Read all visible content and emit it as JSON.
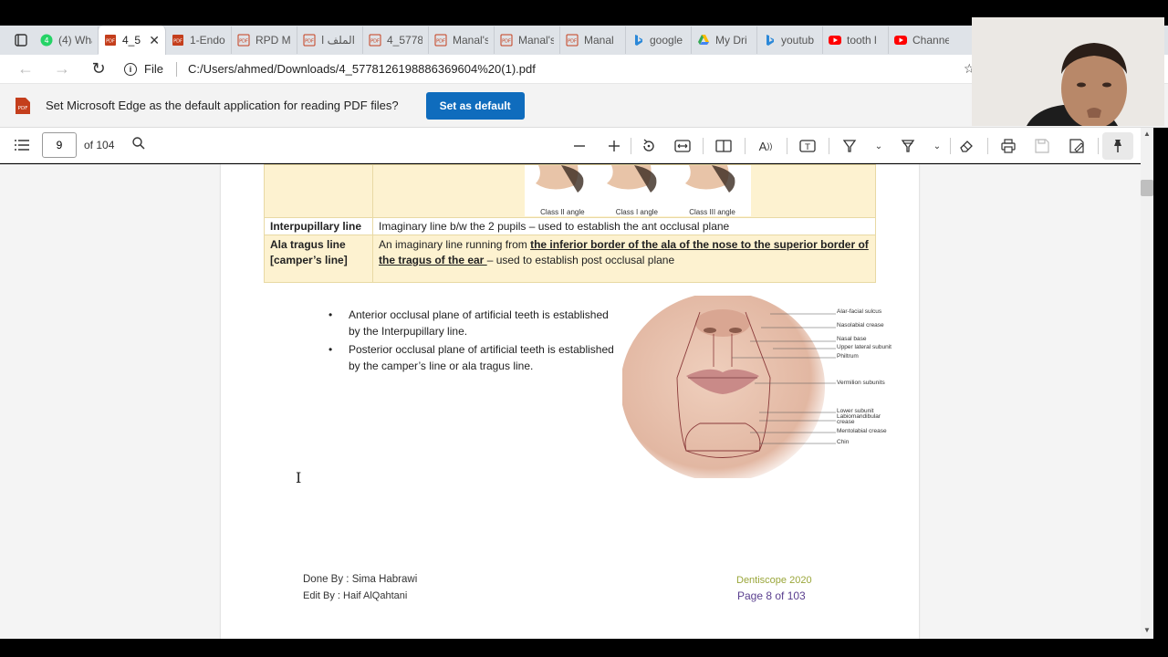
{
  "tabs": [
    {
      "label": "(4) Wha",
      "icon": "whatsapp-icon",
      "active": false
    },
    {
      "label": "4_5",
      "icon": "pdf-icon",
      "active": true
    },
    {
      "label": "1-Endo",
      "icon": "pdf-icon",
      "active": false
    },
    {
      "label": "RPD M",
      "icon": "pdf-icon",
      "active": false
    },
    {
      "label": "الملف ا",
      "icon": "pdf-icon",
      "active": false
    },
    {
      "label": "4_5778",
      "icon": "pdf-icon",
      "active": false
    },
    {
      "label": "Manal's",
      "icon": "pdf-icon",
      "active": false
    },
    {
      "label": "Manal's",
      "icon": "pdf-icon",
      "active": false
    },
    {
      "label": "Manal",
      "icon": "pdf-icon",
      "active": false
    },
    {
      "label": "google",
      "icon": "bing-icon",
      "active": false
    },
    {
      "label": "My Dri",
      "icon": "drive-icon",
      "active": false
    },
    {
      "label": "youtub",
      "icon": "bing-icon",
      "active": false
    },
    {
      "label": "tooth l",
      "icon": "youtube-icon",
      "active": false
    },
    {
      "label": "Channe",
      "icon": "youtube-icon",
      "active": false
    }
  ],
  "address": {
    "scheme": "File",
    "url": "C:/Users/ahmed/Downloads/4_5778126198886369604%20(1).pdf"
  },
  "infobar": {
    "message": "Set Microsoft Edge as the default application for reading PDF files?",
    "button": "Set as default"
  },
  "pdf_toolbar": {
    "page_number": "9",
    "page_total": "of 104"
  },
  "document": {
    "captions": [
      "Class II angle",
      "Class I angle",
      "Class III angle"
    ],
    "rows": [
      {
        "term": "Interpupillary line",
        "text": "Imaginary line b/w the 2 pupils – used to establish the ant occlusal plane"
      },
      {
        "term": "Ala tragus line [camper’s line]",
        "text_pre": "An imaginary line running from ",
        "text_ul": "the inferior border of the ala of the nose to the superior border of the tragus of the ear ",
        "text_post": "– used to establish post occlusal plane"
      }
    ],
    "bullets": [
      "Anterior occlusal plane of artificial teeth is established by the Interpupillary line.",
      "Posterior occlusal plane of artificial teeth is established by the camper’s line or ala tragus line."
    ],
    "face_labels": [
      "Alar-facial sulcus",
      "Nasolabial crease",
      "Nasal base",
      "Upper lateral subunit",
      "Philtrum",
      "Vermilion subunits",
      "Lower subunit",
      "Labiomandibular crease",
      "Mentolabial crease",
      "Chin"
    ],
    "footer": {
      "done_by": "Done By : Sima Habrawi",
      "edit_by": "Edit By : Haif AlQahtani",
      "brand": "Dentiscope 2020",
      "page": "Page 8 of 103"
    }
  },
  "colors": {
    "accent": "#0f6cbd",
    "table_highlight": "#fdf2d0",
    "footer_brand": "#9aa63a",
    "footer_page": "#5a3f8f"
  }
}
